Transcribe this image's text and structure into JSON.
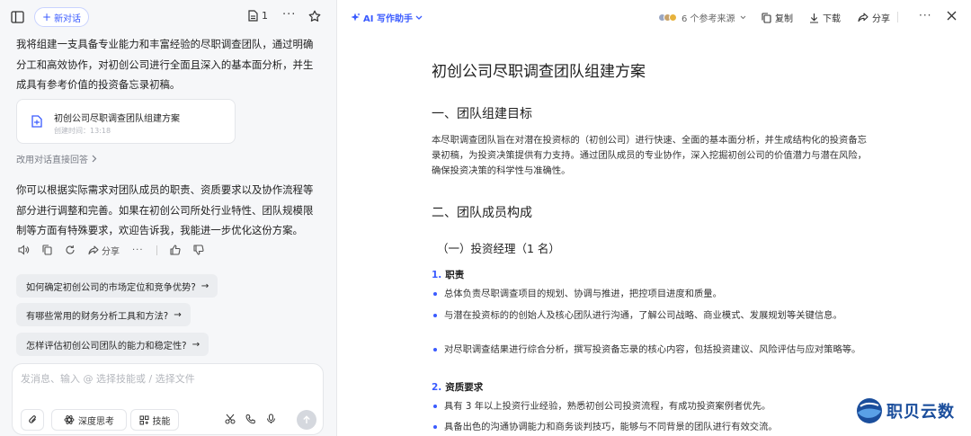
{
  "left": {
    "new_chat_label": "新对话",
    "doc_count": "1",
    "messages": [
      "我将组建一支具备专业能力和丰富经验的尽职调查团队，通过明确分工和高效协作，对初创公司进行全面且深入的基本面分析，并生成具有参考价值的投资备忘录初稿。",
      "你可以根据实际需求对团队成员的职责、资质要求以及协作流程等部分进行调整和完善。如果在初创公司所处行业特性、团队规模限制等方面有特殊要求，欢迎告诉我，我能进一步优化这份方案。"
    ],
    "doc_card": {
      "title": "初创公司尽职调查团队组建方案",
      "time": "创建时间：13:18"
    },
    "switch_link": "改用对话直接回答",
    "actions": {
      "share_label": "分享"
    },
    "suggestions": [
      "如何确定初创公司的市场定位和竞争优势?",
      "有哪些常用的财务分析工具和方法?",
      "怎样评估初创公司团队的能力和稳定性?"
    ],
    "input": {
      "placeholder": "发消息、输入 @ 选择技能或 / 选择文件",
      "deep_think_label": "深度思考",
      "skill_label": "技能"
    }
  },
  "right": {
    "toolbar": {
      "ai_writer_label": "AI 写作助手",
      "sources_label": "6 个参考来源",
      "source_colors": [
        "#9aa7c2",
        "#c7a26a",
        "#e7b23c"
      ],
      "copy_label": "复制",
      "download_label": "下载",
      "share_label": "分享"
    },
    "doc": {
      "title": "初创公司尽职调查团队组建方案",
      "section1_heading": "一、团队组建目标",
      "section1_body": "本尽职调查团队旨在对潜在投资标的（初创公司）进行快速、全面的基本面分析，并生成结构化的投资备忘录初稿，为投资决策提供有力支持。通过团队成员的专业协作，深入挖掘初创公司的价值潜力与潜在风险，确保投资决策的科学性与准确性。",
      "section2_heading": "二、团队成员构成",
      "sub1_heading": "（一）投资经理（1 名）",
      "item1_number": "1.",
      "item1_label": "职责",
      "item1_bullets": [
        "总体负责尽职调查项目的规划、协调与推进，把控项目进度和质量。",
        "与潜在投资标的的创始人及核心团队进行沟通，了解公司战略、商业模式、发展规划等关键信息。",
        "对尽职调查结果进行综合分析，撰写投资备忘录的核心内容，包括投资建议、风险评估与应对策略等。"
      ],
      "item2_number": "2.",
      "item2_label": "资质要求",
      "item2_bullets": [
        "具有 3 年以上投资行业经验，熟悉初创公司投资流程，有成功投资案例者优先。",
        "具备出色的沟通协调能力和商务谈判技巧，能够与不同背景的团队进行有效交流。"
      ]
    }
  },
  "watermark": {
    "text": "职贝云数"
  }
}
